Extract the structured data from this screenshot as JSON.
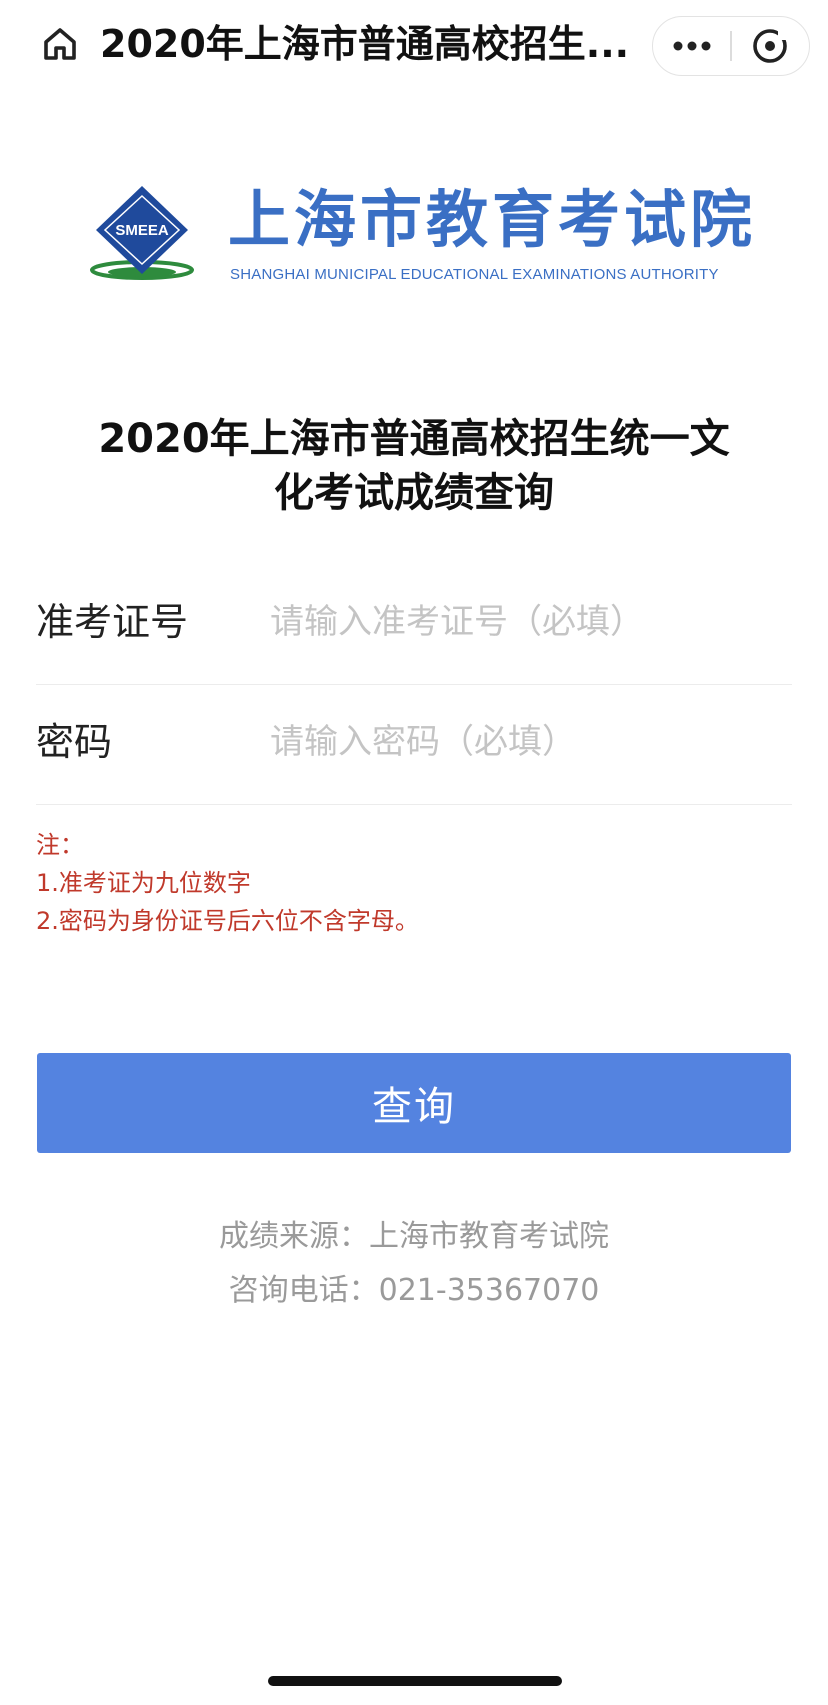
{
  "topbar": {
    "title": "2020年上海市普通高校招生...",
    "home_icon": "home-icon",
    "more_icon": "more-dots-icon",
    "close_icon": "close-target-icon"
  },
  "logo": {
    "emblem_text": "SMEEA",
    "cn_name": "上海市教育考试院",
    "en_name": "SHANGHAI MUNICIPAL EDUCATIONAL EXAMINATIONS AUTHORITY",
    "brand_color": "#3a6fc4"
  },
  "heading": {
    "line1": "2020年上海市普通高校招生统一文",
    "line2": "化考试成绩查询"
  },
  "form": {
    "exam_id": {
      "label": "准考证号",
      "placeholder": "请输入准考证号（必填）",
      "value": ""
    },
    "password": {
      "label": "密码",
      "placeholder": "请输入密码（必填）",
      "value": ""
    }
  },
  "notes": {
    "title": "注：",
    "items": [
      "1.准考证为九位数字",
      "2.密码为身份证号后六位不含字母。"
    ],
    "color": "#c0392b"
  },
  "submit": {
    "label": "查询",
    "color": "#5483e0"
  },
  "footer": {
    "source": "成绩来源：上海市教育考试院",
    "phone": "咨询电话：021-35367070"
  }
}
